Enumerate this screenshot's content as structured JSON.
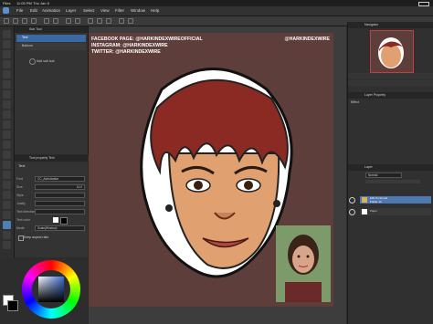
{
  "status": {
    "carrier": "Files",
    "time": "11:05 PM",
    "date": "Thu Jan 5"
  },
  "menu": [
    "File",
    "Edit",
    "Animation",
    "Layer",
    "Select",
    "View",
    "Filter",
    "Window",
    "Help"
  ],
  "subtool": {
    "header": "Sub Tool",
    "items": [
      "Text",
      "Balloon"
    ],
    "add_label": "Add sub tool"
  },
  "tool_property": {
    "header": "Tool property  Text",
    "tool_name": "Text",
    "rows": [
      {
        "label": "Font",
        "value": "CC_AstroAvatar"
      },
      {
        "label": "Size",
        "value": "14.0"
      },
      {
        "label": "Style",
        "value": ""
      },
      {
        "label": "Justify",
        "value": ""
      },
      {
        "label": "Text direction",
        "value": ""
      },
      {
        "label": "Text color",
        "value": ""
      },
      {
        "label": "Mode",
        "value": "Scale(Window)"
      }
    ],
    "checkbox": "Keep aspect ratio"
  },
  "canvas": {
    "line1": "FACEBOOK PAGE: @HARKINDEXWIREOFFICIAL",
    "line2": "INSTAGRAM: @HARKINDEXWIRE",
    "line3": "TWITTER: @HARKINDEXWIRE",
    "handle": "@HARKINDEXWIRE"
  },
  "right": {
    "navigator": "Navigator",
    "layer_property": "Layer Property",
    "effect": "Effect",
    "layer": "Layer",
    "blend": "Normal",
    "layers": [
      {
        "name": "100 %  Normal",
        "sub": "Folder 12",
        "selected": true
      },
      {
        "name": "Paper",
        "sub": "",
        "selected": false
      }
    ]
  },
  "colors": {
    "accent": "#4f7fb3",
    "canvas_bg": "#5e3e3a",
    "hair": "#8a2a22",
    "skin": "#e0a070"
  }
}
